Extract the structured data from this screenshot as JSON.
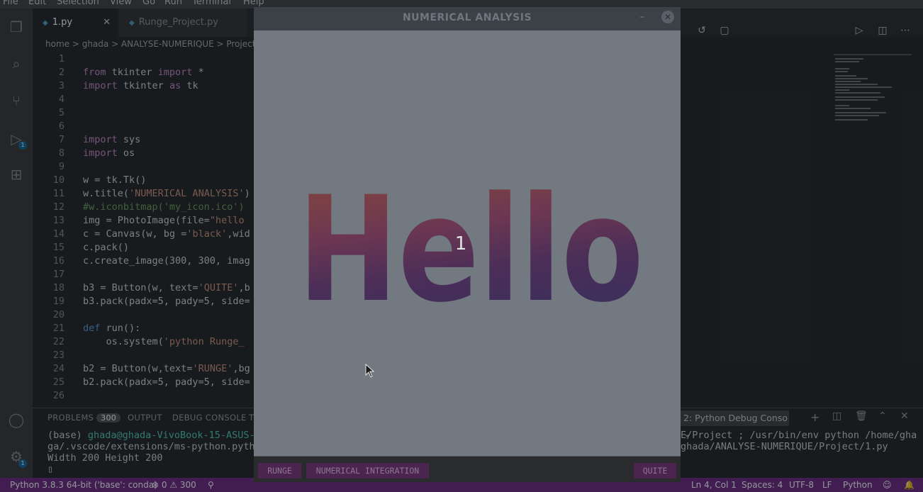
{
  "vscode": {
    "menu": [
      "File",
      "Edit",
      "Selection",
      "View",
      "Go",
      "Run",
      "Terminal",
      "Help"
    ],
    "tabs": [
      {
        "label": "1.py",
        "close": "✕"
      },
      {
        "label": "Runge_Project.py"
      }
    ],
    "breadcrumb": "home > ghada > ANALYSE-NUMERIQUE > Project",
    "activity_badges": {
      "run": "1",
      "settings": "1"
    },
    "code_lines": [
      {
        "n": "1",
        "html": ""
      },
      {
        "n": "2",
        "html": "<span class='kw'>from</span> tkinter <span class='kw'>import</span> *"
      },
      {
        "n": "3",
        "html": "<span class='kw'>import</span> tkinter <span class='kw'>as</span> tk"
      },
      {
        "n": "4",
        "html": ""
      },
      {
        "n": "5",
        "html": ""
      },
      {
        "n": "6",
        "html": ""
      },
      {
        "n": "7",
        "html": "<span class='kw'>import</span> sys"
      },
      {
        "n": "8",
        "html": "<span class='kw'>import</span> os"
      },
      {
        "n": "9",
        "html": ""
      },
      {
        "n": "10",
        "html": "w = tk.Tk()"
      },
      {
        "n": "11",
        "html": "w.title(<span class='str'>'NUMERICAL ANALYSIS'</span>)"
      },
      {
        "n": "12",
        "html": "<span class='cm'>#w.iconbitmap('my_icon.ico')</span>"
      },
      {
        "n": "13",
        "html": "img = PhotoImage(file=<span class='str'>\"hello</span>"
      },
      {
        "n": "14",
        "html": "c = Canvas(w, bg =<span class='str'>'black'</span>,wid"
      },
      {
        "n": "15",
        "html": "c.pack()"
      },
      {
        "n": "16",
        "html": "c.create_image(300, 300, imag"
      },
      {
        "n": "17",
        "html": ""
      },
      {
        "n": "18",
        "html": "b3 = Button(w, text=<span class='str'>'QUITE'</span>,b"
      },
      {
        "n": "19",
        "html": "b3.pack(padx=5, pady=5, side="
      },
      {
        "n": "20",
        "html": ""
      },
      {
        "n": "21",
        "html": "<span class='kw2'>def</span> run():"
      },
      {
        "n": "22",
        "html": "    os.system(<span class='str'>'python Runge_</span>"
      },
      {
        "n": "23",
        "html": ""
      },
      {
        "n": "24",
        "html": "b2 = Button(w,text=<span class='str'>'RUNGE'</span>,bg"
      },
      {
        "n": "25",
        "html": "b2.pack(padx=5, pady=5, side="
      },
      {
        "n": "26",
        "html": ""
      }
    ],
    "panel": {
      "tabs": [
        "PROBLEMS",
        "OUTPUT",
        "DEBUG CONSOLE",
        "T"
      ],
      "problems_count": "300",
      "terminal_select": "2: Python Debug Conso",
      "terminal_lines": [
        {
          "prompt": "(base) ",
          "user": "ghada@ghada-VivoBook-15-ASUS-",
          "rest": ""
        },
        {
          "prompt": "",
          "user": "",
          "rest": "ga/.vscode/extensions/ms-python.pytho"
        },
        {
          "prompt": "",
          "user": "",
          "rest": "Width 200 Height 200"
        }
      ],
      "terminal_right_1": "E/Project ; /usr/bin/env python /home/gha",
      "terminal_right_2": "ghada/ANALYSE-NUMERIQUE/Project/1.py"
    },
    "status": {
      "python": "Python 3.8.3 64-bit ('base': conda)",
      "problems": "⊗ 0 ⚠ 300",
      "position": "Ln 4, Col 1",
      "spaces": "Spaces: 4",
      "encoding": "UTF-8",
      "eol": "LF",
      "language": "Python"
    }
  },
  "tk_app": {
    "title": "NUMERICAL ANALYSIS",
    "hello_text": "Hello",
    "counter": "1",
    "buttons": {
      "runge": "RUNGE",
      "integration": "NUMERICAL INTEGRATION",
      "quit": "QUITE"
    },
    "colors": {
      "button_bg": "#4b2550",
      "canvas_bg": "#737980"
    }
  }
}
